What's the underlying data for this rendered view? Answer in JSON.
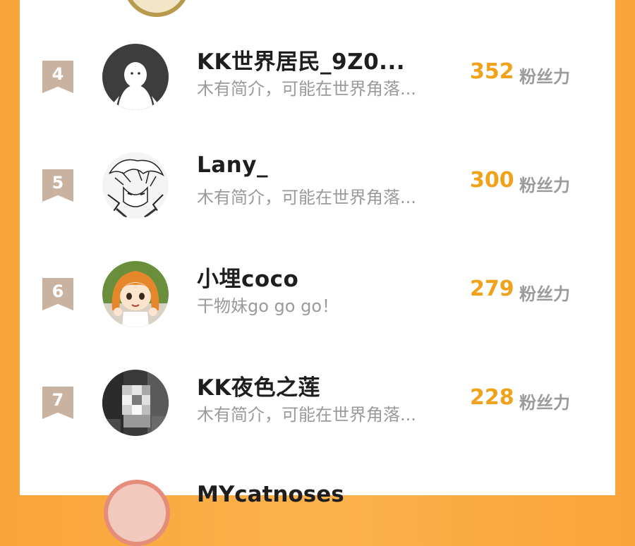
{
  "rows": [
    {
      "rank": "4",
      "name": "KK世界居民_9Z0...",
      "bio": "木有简介，可能在世界角落...",
      "score": "352",
      "score_label": "粉丝力",
      "avatar": "ghost-avatar"
    },
    {
      "rank": "5",
      "name": "Lany_",
      "bio": "木有简介，可能在世界角落...",
      "score": "300",
      "score_label": "粉丝力",
      "avatar": "manga-sketch-avatar"
    },
    {
      "rank": "6",
      "name": "小埋coco",
      "bio": "干物妹go go go！",
      "score": "279",
      "score_label": "粉丝力",
      "avatar": "anime-girl-avatar"
    },
    {
      "rank": "7",
      "name": "KK夜色之莲",
      "bio": "木有简介，可能在世界角落...",
      "score": "228",
      "score_label": "粉丝力",
      "avatar": "pixelated-cat-avatar"
    }
  ],
  "next_row_partial_name": "MYcatnoses",
  "colors": {
    "score": "#f0a21a",
    "rank_badge": "#c9b29f",
    "background": "#f9a43a"
  }
}
